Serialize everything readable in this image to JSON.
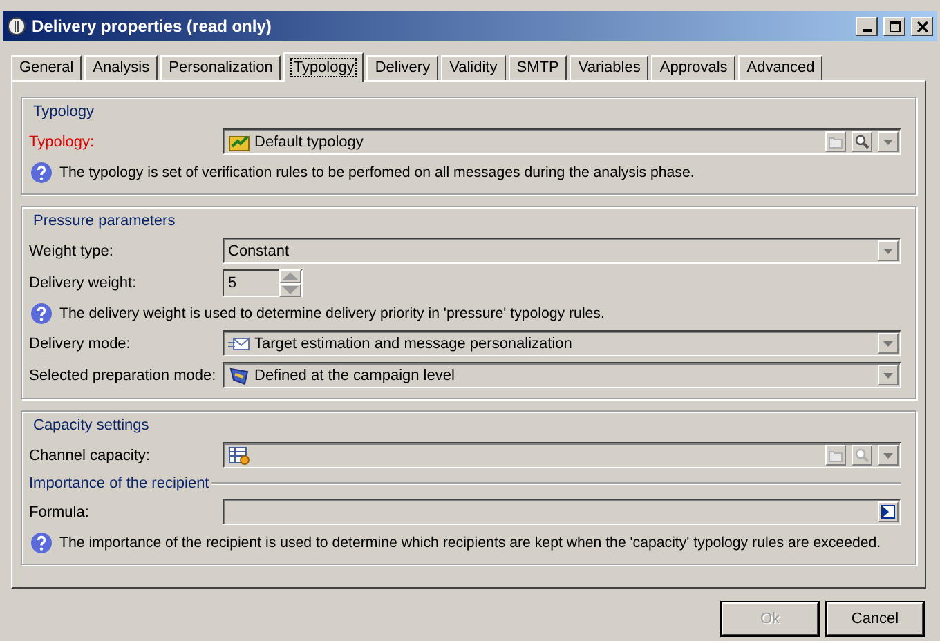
{
  "window": {
    "title": "Delivery properties (read only)"
  },
  "tabs": [
    {
      "label": "General",
      "selected": false
    },
    {
      "label": "Analysis",
      "selected": false
    },
    {
      "label": "Personalization",
      "selected": false
    },
    {
      "label": "Typology",
      "selected": true
    },
    {
      "label": "Delivery",
      "selected": false
    },
    {
      "label": "Validity",
      "selected": false
    },
    {
      "label": "SMTP",
      "selected": false
    },
    {
      "label": "Variables",
      "selected": false
    },
    {
      "label": "Approvals",
      "selected": false
    },
    {
      "label": "Advanced",
      "selected": false
    }
  ],
  "sections": [
    {
      "title": "Typology",
      "rows": [
        {
          "kind": "lookup",
          "label": "Typology:",
          "required": true,
          "value": "Default typology",
          "disabled": false
        },
        {
          "kind": "hint",
          "text": "The typology is set of verification rules to be perfomed on all messages during the analysis phase."
        }
      ]
    },
    {
      "title": "Pressure parameters",
      "rows": [
        {
          "kind": "combo",
          "label": "Weight type:",
          "required": false,
          "value": "Constant"
        },
        {
          "kind": "spin",
          "label": "Delivery weight:",
          "required": false,
          "value": "5"
        },
        {
          "kind": "hint",
          "text": "The delivery weight is used to determine delivery priority in 'pressure' typology rules."
        },
        {
          "kind": "combo",
          "label": "Delivery mode:",
          "required": false,
          "value": "Target estimation and message personalization"
        },
        {
          "kind": "combo",
          "label": "Selected preparation mode:",
          "required": false,
          "value": "Defined at the campaign level"
        }
      ]
    },
    {
      "title": "Capacity settings",
      "rows": [
        {
          "kind": "lookup",
          "label": "Channel capacity:",
          "required": false,
          "value": "",
          "disabled": true
        },
        {
          "kind": "subheading",
          "text": "Importance of the recipient"
        },
        {
          "kind": "formula",
          "label": "Formula:",
          "required": false,
          "value": ""
        },
        {
          "kind": "hint",
          "text": "The importance of the recipient is used to determine which recipients are kept when the 'capacity' typology rules are exceeded."
        }
      ]
    }
  ],
  "buttons": [
    {
      "label": "Ok",
      "disabled": true
    },
    {
      "label": "Cancel",
      "disabled": false
    }
  ]
}
